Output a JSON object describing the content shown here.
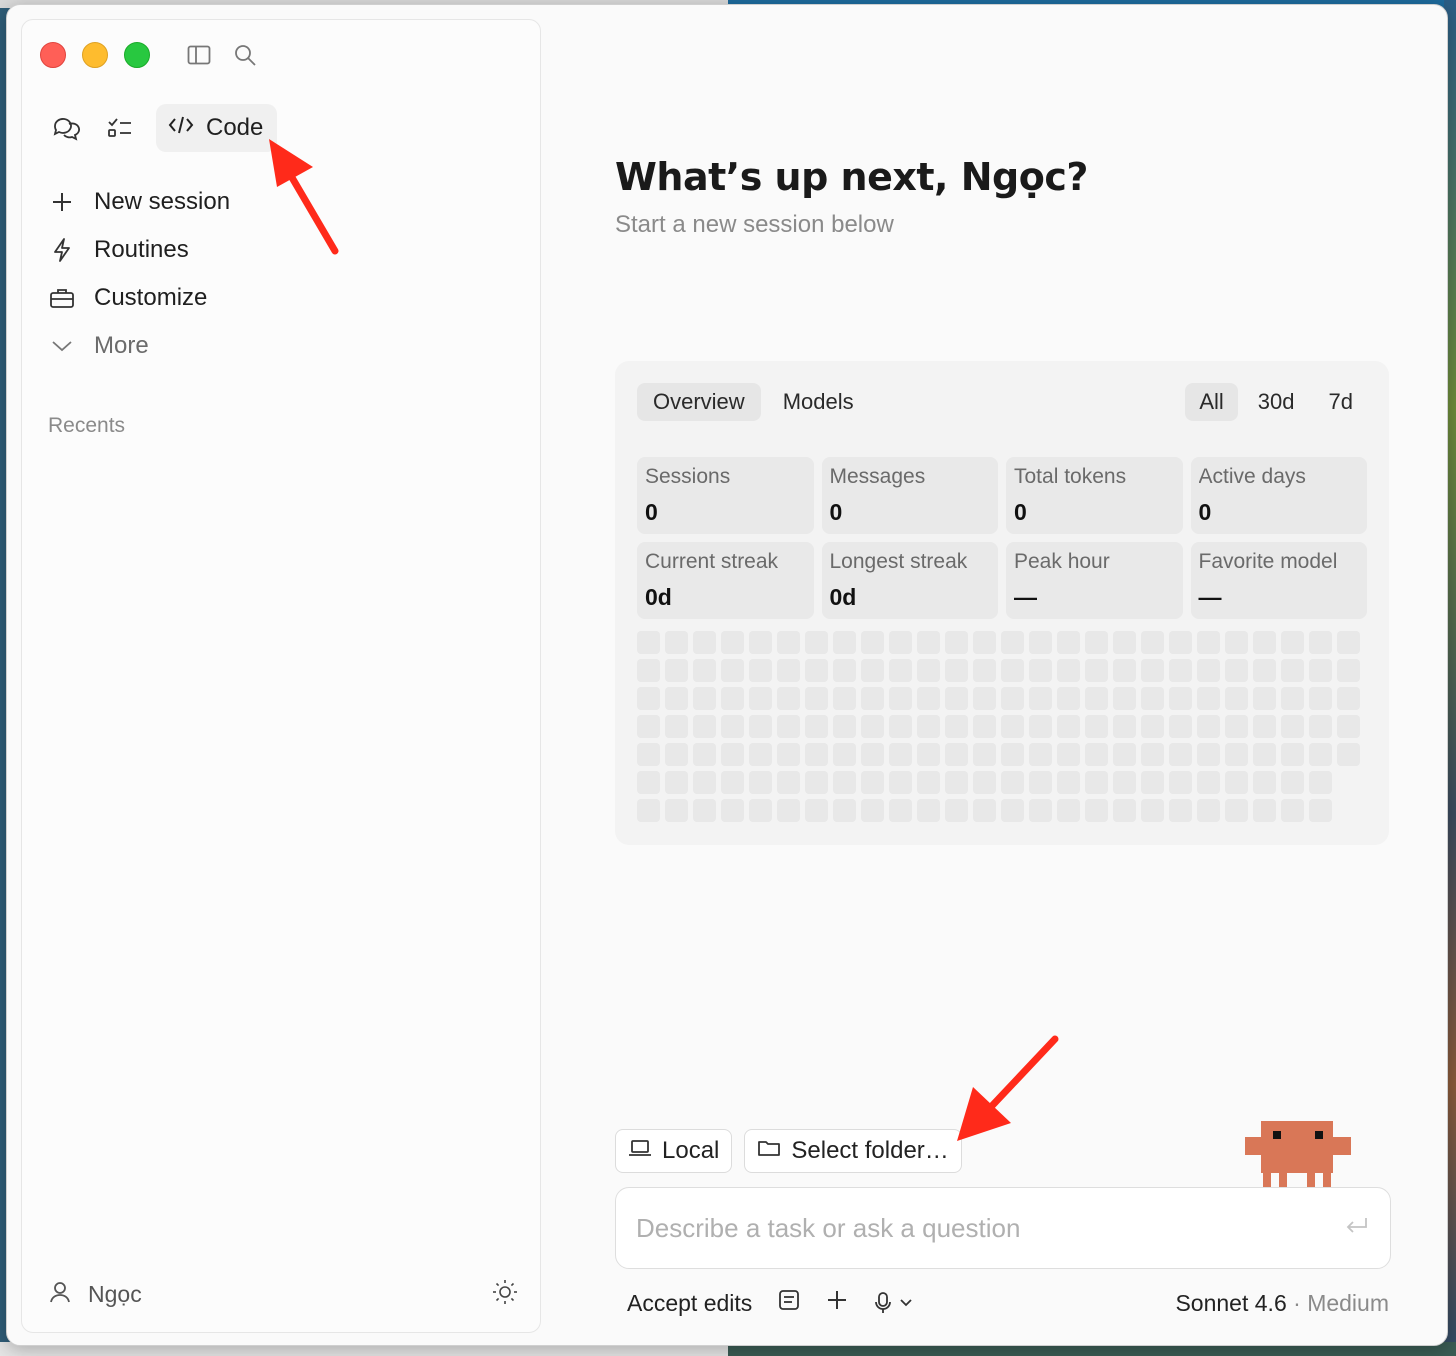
{
  "sidebar": {
    "modes": [
      {
        "name": "chat",
        "icon": "chat-bubbles-icon"
      },
      {
        "name": "tasks",
        "icon": "checklist-icon"
      },
      {
        "name": "code",
        "icon": "code-icon",
        "label": "Code",
        "active": true
      }
    ],
    "nav": [
      {
        "label": "New session",
        "icon": "plus-icon"
      },
      {
        "label": "Routines",
        "icon": "lightning-icon"
      },
      {
        "label": "Customize",
        "icon": "briefcase-icon"
      },
      {
        "label": "More",
        "icon": "chevron-down-icon"
      }
    ],
    "recents_label": "Recents",
    "user_name": "Ngọc"
  },
  "main": {
    "heading": "What’s up next, Ngọc?",
    "subheading": "Start a new session below",
    "stats": {
      "tabs": [
        "Overview",
        "Models"
      ],
      "active_tab": "Overview",
      "ranges": [
        "All",
        "30d",
        "7d"
      ],
      "active_range": "All",
      "cards": [
        {
          "label": "Sessions",
          "value": "0"
        },
        {
          "label": "Messages",
          "value": "0"
        },
        {
          "label": "Total tokens",
          "value": "0"
        },
        {
          "label": "Active days",
          "value": "0"
        },
        {
          "label": "Current streak",
          "value": "0d"
        },
        {
          "label": "Longest streak",
          "value": "0d"
        },
        {
          "label": "Peak hour",
          "value": "—"
        },
        {
          "label": "Favorite model",
          "value": "—"
        }
      ],
      "heatmap": {
        "rows": 7,
        "cols": 26,
        "last_col_rows": 5
      }
    },
    "chips": {
      "local": "Local",
      "folder": "Select folder…"
    },
    "input": {
      "placeholder": "Describe a task or ask a question",
      "value": ""
    },
    "bottom": {
      "mode": "Accept edits",
      "model": "Sonnet 4.6",
      "separator": " · ",
      "effort": "Medium"
    }
  },
  "colors": {
    "accent_orange": "#d97757",
    "annotation_red": "#ff2a1a",
    "traffic_red": "#ff5f57",
    "traffic_yellow": "#febc2e",
    "traffic_green": "#28c840"
  }
}
